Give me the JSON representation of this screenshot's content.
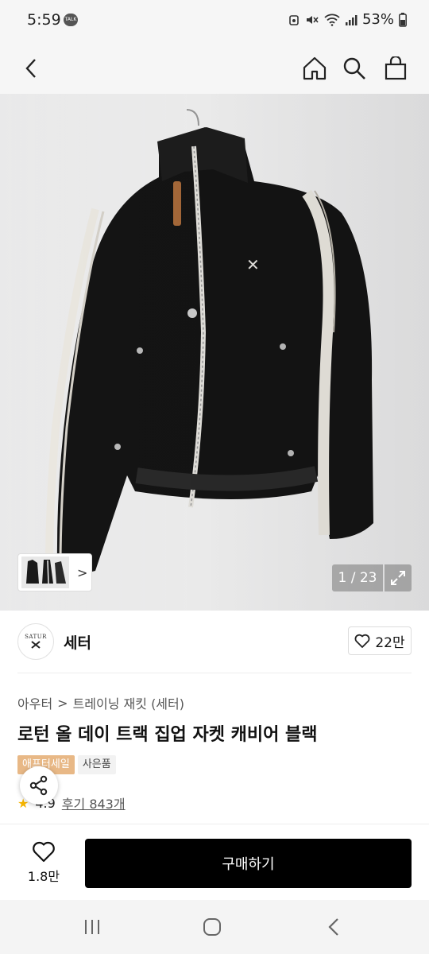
{
  "status": {
    "time": "5:59",
    "talk_badge": "TALK",
    "battery": "53%"
  },
  "toolbar": {
    "back_icon": "chevron-left-icon",
    "home_icon": "home-icon",
    "search_icon": "search-icon",
    "cart_icon": "shopping-bag-icon"
  },
  "gallery": {
    "counter": "1 / 23",
    "thumb_arrow": ">",
    "expand_icon": "expand-icon"
  },
  "brand": {
    "logo_text": "SATUR",
    "name": "세터",
    "likes": "22만"
  },
  "product": {
    "category_main": "아우터",
    "category_sep": ">",
    "category_sub": "트레이닝 재킷 (세터)",
    "title": "로턴 올 데이 트랙 집업 자켓 캐비어 블랙",
    "tag_sale": "애프터세일",
    "tag_gift": "사은품",
    "rating": "4.9",
    "review_label": "후기 843개"
  },
  "bottom": {
    "wish_count": "1.8만",
    "buy_label": "구매하기"
  },
  "colors": {
    "accent": "#000000",
    "sale_tag": "#e8b886",
    "star": "#f5b400"
  }
}
